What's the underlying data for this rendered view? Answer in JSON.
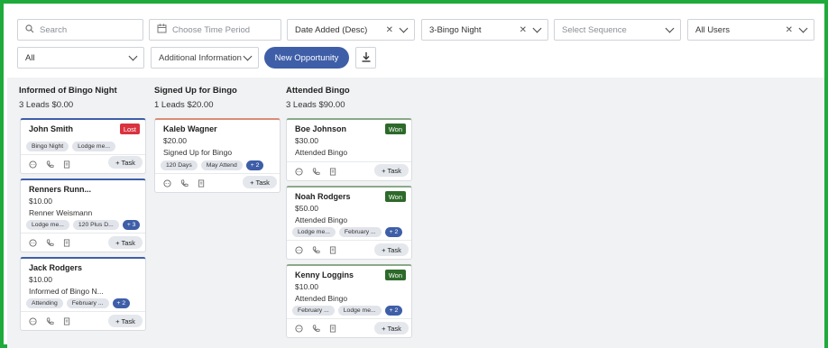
{
  "filters": {
    "search_placeholder": "Search",
    "time_placeholder": "Choose Time Period",
    "sort_value": "Date Added (Desc)",
    "pipeline_value": "3-Bingo Night",
    "sequence_placeholder": "Select Sequence",
    "users_value": "All Users",
    "status_value": "All",
    "additional_info_placeholder": "Additional Information",
    "new_opportunity_label": "New Opportunity"
  },
  "task_label": "+ Task",
  "columns": [
    {
      "title": "Informed of Bingo Night",
      "summary": "3 Leads $0.00",
      "cards": [
        {
          "name": "John Smith",
          "badge": "Lost",
          "tags": [
            "Bingo Night",
            "Lodge me..."
          ]
        },
        {
          "name": "Renners Runn...",
          "amount": "$10.00",
          "detail": "Renner Weismann",
          "tags": [
            "Lodge me...",
            "120 Plus D..."
          ],
          "more": "+ 3"
        },
        {
          "name": "Jack Rodgers",
          "amount": "$10.00",
          "detail": "Informed of Bingo N...",
          "tags": [
            "Attending",
            "February ..."
          ],
          "more": "+ 2"
        }
      ]
    },
    {
      "title": "Signed Up for Bingo",
      "summary": "1 Leads $20.00",
      "cards": [
        {
          "name": "Kaleb Wagner",
          "amount": "$20.00",
          "detail": "Signed Up for Bingo",
          "tags": [
            "120 Days",
            "May Attend"
          ],
          "more": "+ 2"
        }
      ]
    },
    {
      "title": "Attended Bingo",
      "summary": "3 Leads $90.00",
      "cards": [
        {
          "name": "Boe Johnson",
          "badge": "Won",
          "amount": "$30.00",
          "detail": "Attended Bingo"
        },
        {
          "name": "Noah Rodgers",
          "badge": "Won",
          "amount": "$50.00",
          "detail": "Attended Bingo",
          "tags": [
            "Lodge me...",
            "February ..."
          ],
          "more": "+ 2"
        },
        {
          "name": "Kenny Loggins",
          "badge": "Won",
          "amount": "$10.00",
          "detail": "Attended Bingo",
          "tags": [
            "February ...",
            "Lodge me..."
          ],
          "more": "+ 2"
        }
      ]
    }
  ]
}
